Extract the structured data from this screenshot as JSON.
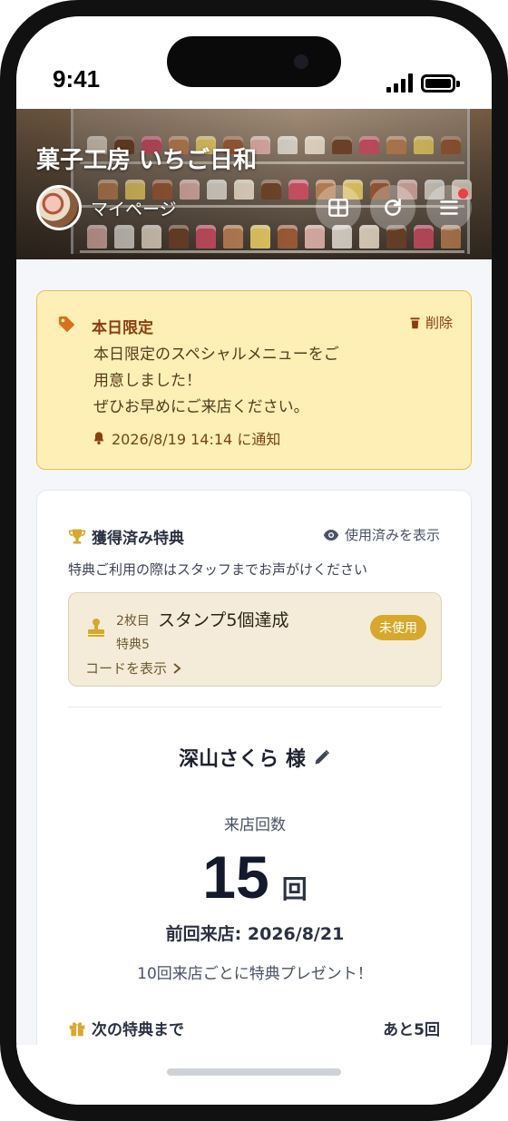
{
  "status_bar": {
    "time": "9:41"
  },
  "header": {
    "shop_name": "菓子工房 いちご日和",
    "mypage_label": "マイページ",
    "buttons": [
      "grid-icon",
      "refresh-icon",
      "menu-icon"
    ],
    "has_notification": true
  },
  "notice": {
    "title": "本日限定",
    "delete_label": "削除",
    "body_line1": "本日限定のスペシャルメニューをご",
    "body_line2": "用意しました！",
    "body_line3": "ぜひお早めにご来店ください。",
    "notified_at": "2026/8/19 14:14 に通知"
  },
  "benefits": {
    "title": "獲得済み特典",
    "show_used_label": "使用済みを表示",
    "note": "特典ご利用の際はスタッフまでお声がけください",
    "coupon": {
      "rank": "2枚目",
      "title": "スタンプ5個達成",
      "subtitle": "特典5",
      "status": "未使用",
      "code_link": "コードを表示"
    }
  },
  "member": {
    "name": "深山さくら 様",
    "visits_label": "来店回数",
    "visits": "15",
    "visits_unit": "回",
    "last_visit": "前回来店: 2026/8/21",
    "promo": "10回来店ごとに特典プレゼント！",
    "next_reward_label": "次の特典まで",
    "next_reward_remaining": "あと5回"
  },
  "colors": {
    "notice_bg": "#fdefb6",
    "notice_accent": "#8a3d10",
    "badge": "#d6a82b",
    "notification_dot": "#ef3e4a"
  }
}
